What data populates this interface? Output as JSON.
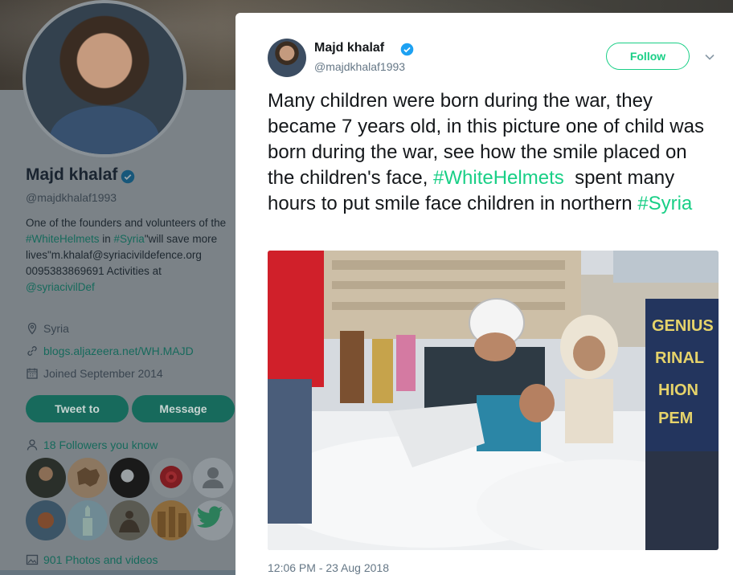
{
  "profile": {
    "name": "Majd khalaf",
    "handle": "@majdkhalaf1993",
    "bio_part1": "One of the founders and volunteers of the ",
    "bio_tag1": "#WhiteHelmets",
    "bio_part2": " in ",
    "bio_tag2": "#Syria",
    "bio_part3": "\"will save more lives\"m.khalaf@syriacivildefence.org 0095383869691 Activities at ",
    "bio_mention": "@syriacivilDef",
    "location": "Syria",
    "website": "blogs.aljazeera.net/WH.MAJD",
    "joined": "Joined September 2014",
    "tweet_to_label": "Tweet to",
    "message_label": "Message",
    "followers_you_know": "18 Followers you know",
    "photos_videos": "901 Photos and videos",
    "icons": [
      "location-icon",
      "link-icon",
      "calendar-icon",
      "people-icon",
      "photo-icon",
      "verified-icon"
    ]
  },
  "tweet": {
    "author_name": "Majd khalaf",
    "author_handle": "@majdkhalaf1993",
    "follow_label": "Follow",
    "text_part1": "Many children were born during the war, they became 7 years old, in this picture one of child was born during the war, see how the smile placed on the children's face, ",
    "hashtag1": "#WhiteHelmets",
    "text_part2": "  spent many hours to put smile face children in northern ",
    "hashtag2": "#Syria",
    "timestamp": "12:06 PM - 23 Aug 2018"
  },
  "colors": {
    "accent": "#19cf86",
    "text_primary": "#14171a",
    "text_secondary": "#657786",
    "verified": "#1da1f2",
    "dim_overlay_profile": "#7b8287"
  }
}
